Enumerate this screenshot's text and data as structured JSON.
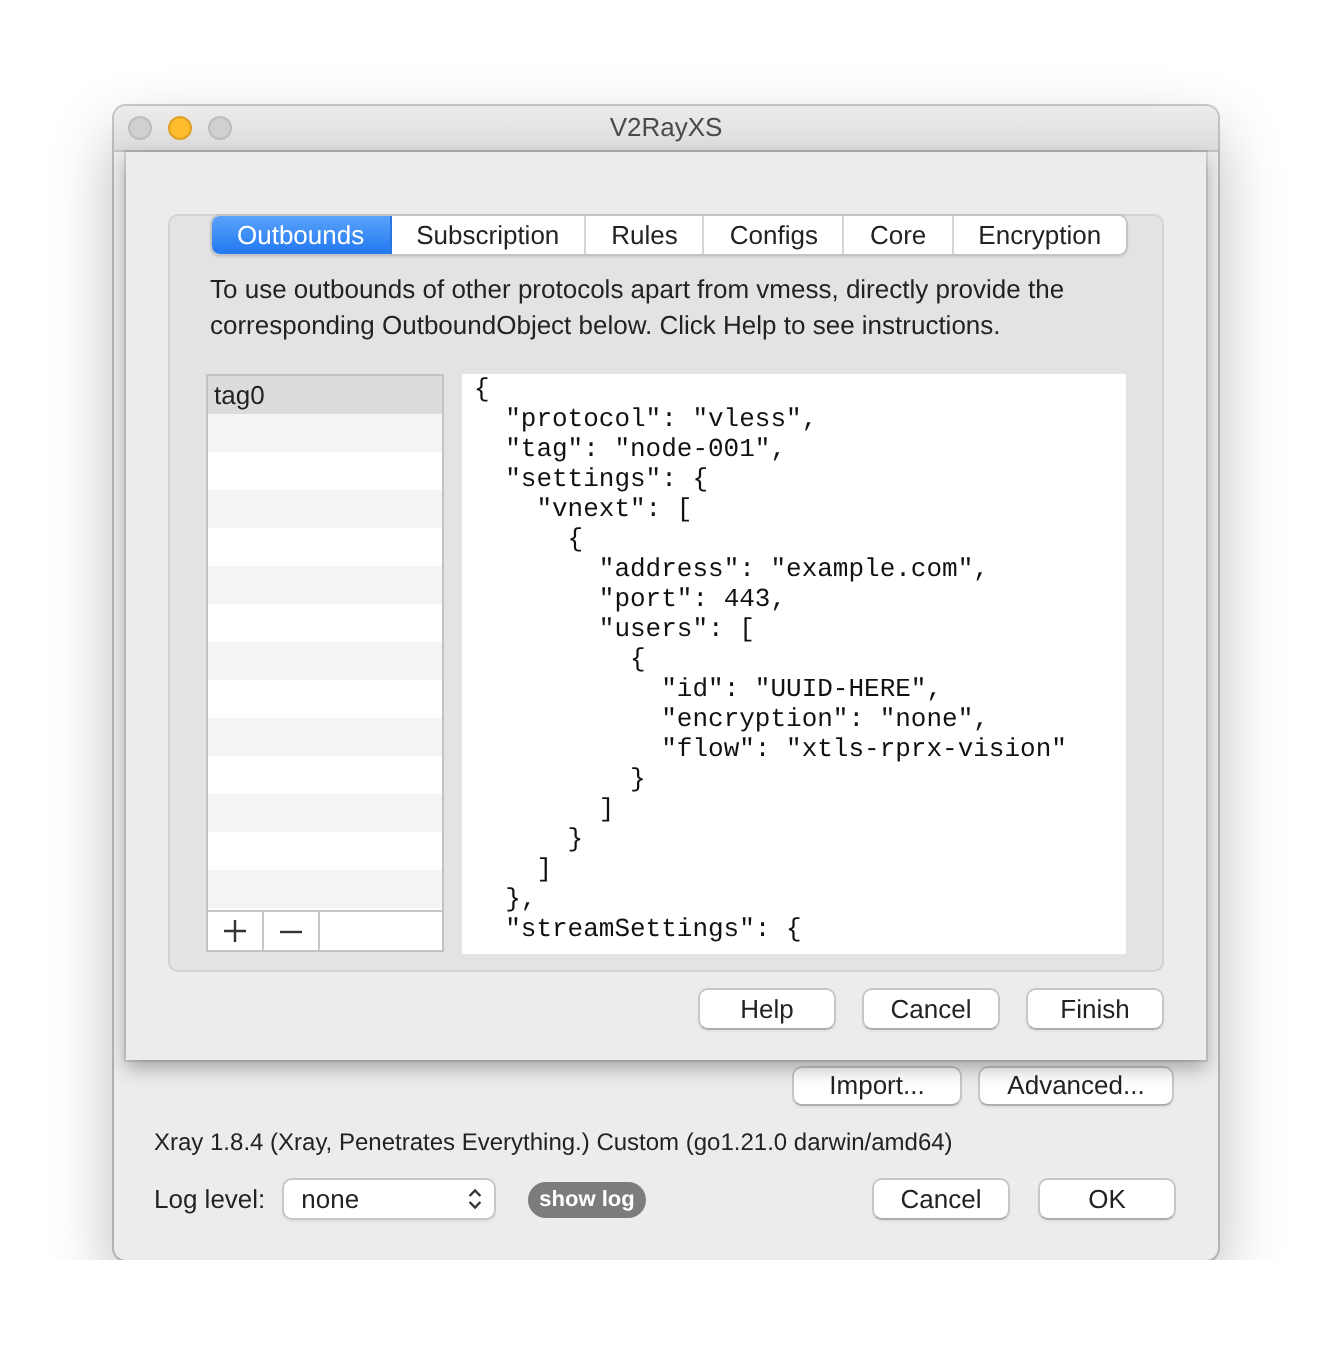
{
  "window": {
    "title": "V2RayXS",
    "controls": [
      {
        "kind": "close",
        "enabled": false
      },
      {
        "kind": "minimize",
        "enabled": true
      },
      {
        "kind": "zoom",
        "enabled": false
      }
    ]
  },
  "sheet": {
    "tabs": [
      {
        "label": "Outbounds",
        "selected": true
      },
      {
        "label": "Subscription",
        "selected": false
      },
      {
        "label": "Rules",
        "selected": false
      },
      {
        "label": "Configs",
        "selected": false
      },
      {
        "label": "Core",
        "selected": false
      },
      {
        "label": "Encryption",
        "selected": false
      }
    ],
    "description": "To use outbounds of other protocols apart from vmess, directly provide the corresponding OutboundObject below. Click Help to see instructions.",
    "outbounds": [
      {
        "label": "tag0",
        "selected": true
      }
    ],
    "editor": {
      "lines": [
        "{",
        "  \"protocol\": \"vless\",",
        "  \"tag\": \"node-001\",",
        "  \"settings\": {",
        "    \"vnext\": [",
        "      {",
        "        \"address\": \"example.com\",",
        "        \"port\": 443,",
        "        \"users\": [",
        "          {",
        "            \"id\": \"UUID-HERE\",",
        "            \"encryption\": \"none\",",
        "            \"flow\": \"xtls-rprx-vision\"",
        "          }",
        "        ]",
        "      }",
        "    ]",
        "  },",
        "  \"streamSettings\": {"
      ]
    },
    "buttons": [
      "Help",
      "Cancel",
      "Finish"
    ]
  },
  "actions": [
    "Import...",
    "Advanced..."
  ],
  "version": "Xray 1.8.4 (Xray, Penetrates Everything.) Custom (go1.21.0 darwin/amd64)",
  "log": {
    "label": "Log level:",
    "value": "none",
    "show_button": "show log"
  },
  "footer_buttons": [
    "Cancel",
    "OK"
  ]
}
